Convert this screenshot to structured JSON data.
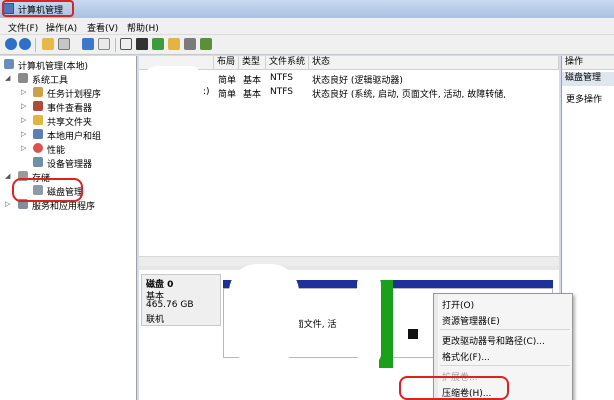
{
  "window": {
    "title": "计算机管理"
  },
  "menu": [
    "文件(F)",
    "操作(A)",
    "查看(V)",
    "帮助(H)"
  ],
  "toolbar_icons": [
    "back-icon",
    "forward-icon",
    "folder-up-icon",
    "console-tree-icon",
    "help-icon",
    "properties-icon",
    "refresh-icon",
    "delete-icon",
    "check-icon",
    "open-folder-icon",
    "search-icon",
    "export-icon"
  ],
  "tree": {
    "root": "计算机管理(本地)",
    "system_tools": "系统工具",
    "items": [
      "任务计划程序",
      "事件查看器",
      "共享文件夹",
      "本地用户和组",
      "性能",
      "设备管理器"
    ],
    "storage": "存储",
    "disk_management": "磁盘管理",
    "services": "服务和应用程序"
  },
  "volume_table": {
    "headers": [
      "布局",
      "类型",
      "文件系统",
      "状态"
    ],
    "rows": [
      {
        "prefix": "",
        "layout": "简单",
        "type": "基本",
        "fs": "NTFS",
        "status": "状态良好 (逻辑驱动器)"
      },
      {
        "prefix": ":)",
        "layout": "简单",
        "type": "基本",
        "fs": "NTFS",
        "status": "状态良好 (系统, 启动, 页面文件, 活动, 故障转储, 主"
      }
    ]
  },
  "disk": {
    "name": "磁盘 0",
    "kind": "基本",
    "size": "465.76 GB",
    "status": "联机",
    "partition_text": ", 页面文件, 活"
  },
  "actions": {
    "header": "操作",
    "section": "磁盘管理",
    "more": "更多操作"
  },
  "context_menu": {
    "items": [
      "打开(O)",
      "资源管理器(E)",
      "更改驱动器号和路径(C)...",
      "格式化(F)..."
    ],
    "disabled_partial": "扩展卷...",
    "shrink": "压缩卷(H)..."
  },
  "colors": {
    "annotation": "#d22222",
    "primary_partition_bar": "#1f2f9c",
    "logical_partition_bar": "#1aa01a"
  }
}
